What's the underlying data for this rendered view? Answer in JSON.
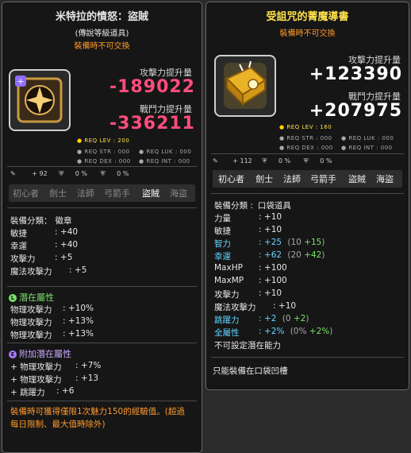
{
  "left": {
    "title": "米特拉的憤怒：盜賊",
    "subtitle": "(傳說等級道具)",
    "untradeable": "裝備時不可交換",
    "attack_label": "攻擊力提升量",
    "attack_value": "-189022",
    "power_label": "戰鬥力提升量",
    "power_value": "-336211",
    "req_lev": "REQ LEV : 200",
    "req_str": "REQ STR : 000",
    "req_luk": "REQ LUK : 000",
    "req_dex": "REQ DEX : 000",
    "req_int": "REQ INT : 000",
    "mini_stats": [
      "+ 92",
      "0 %",
      "0 %"
    ],
    "jobs": [
      "初心者",
      "劍士",
      "法師",
      "弓箭手",
      "盜賊",
      "海盜"
    ],
    "stats": [
      {
        "label": "裝備分類",
        "value": "徽章"
      },
      {
        "label": "敏捷",
        "value": "+40"
      },
      {
        "label": "幸運",
        "value": "+40"
      },
      {
        "label": "攻擊力",
        "value": "+5"
      },
      {
        "label": "魔法攻擊力",
        "value": "+5"
      }
    ],
    "potential_title": "潛在屬性",
    "potential": [
      {
        "label": "物理攻擊力",
        "value": "+10%"
      },
      {
        "label": "物理攻擊力",
        "value": "+13%"
      },
      {
        "label": "物理攻擊力",
        "value": "+13%"
      }
    ],
    "bonus_title": "附加潛在屬性",
    "bonus": [
      {
        "label": "物理攻擊力",
        "value": "+7%"
      },
      {
        "label": "物理攻擊力",
        "value": "+13"
      },
      {
        "label": "跳躍力",
        "value": "+6"
      }
    ],
    "note": "裝備時可獲得僅限1次魅力150的經驗值。(超過每日限制、最大值時除外)"
  },
  "right": {
    "title": "受詛咒的菁魔導書",
    "untradeable": "裝備時不可交換",
    "attack_label": "攻擊力提升量",
    "attack_value": "+123390",
    "power_label": "戰鬥力提升量",
    "power_value": "+207975",
    "req_lev": "REQ LEV : 160",
    "req_str": "REQ STR : 000",
    "req_luk": "REQ LUK : 000",
    "req_dex": "REQ DEX : 000",
    "req_int": "REQ INT : 000",
    "mini_stats": [
      "+ 112",
      "0 %",
      "0 %"
    ],
    "jobs": [
      "初心者",
      "劍士",
      "法師",
      "弓箭手",
      "盜賊",
      "海盜"
    ],
    "stats": [
      {
        "label": "裝備分類",
        "value": "口袋道具",
        "extra": "",
        "color": ""
      },
      {
        "label": "力量",
        "value": "+10",
        "extra": "",
        "color": ""
      },
      {
        "label": "敏捷",
        "value": "+10",
        "extra": "",
        "color": ""
      },
      {
        "label": "智力",
        "value": "+25",
        "extra": "(10 +15)",
        "color": "cyan"
      },
      {
        "label": "幸運",
        "value": "+62",
        "extra": "(20 +42)",
        "color": "cyan"
      },
      {
        "label": "MaxHP",
        "value": "+100",
        "extra": "",
        "color": ""
      },
      {
        "label": "MaxMP",
        "value": "+100",
        "extra": "",
        "color": ""
      },
      {
        "label": "攻擊力",
        "value": "+10",
        "extra": "",
        "color": ""
      },
      {
        "label": "魔法攻擊力",
        "value": "+10",
        "extra": "",
        "color": ""
      },
      {
        "label": "跳躍力",
        "value": "+2",
        "extra": "(0 +2)",
        "color": "cyan"
      },
      {
        "label": "全屬性",
        "value": "+2%",
        "extra": "(0% +2%)",
        "color": "cyan"
      },
      {
        "label": "不可設定潛在能力",
        "value": "",
        "extra": "",
        "color": ""
      }
    ],
    "slot_note": "只能裝備在口袋凹槽"
  }
}
